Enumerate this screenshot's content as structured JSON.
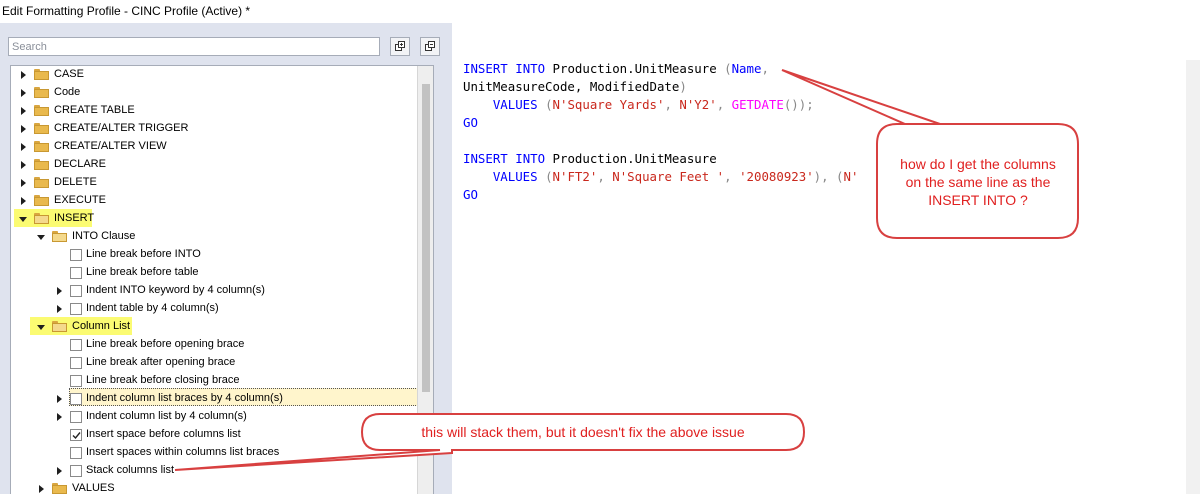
{
  "window": {
    "title": "Edit Formatting Profile - CINC Profile (Active) *"
  },
  "search": {
    "placeholder": "Search",
    "value": ""
  },
  "toolbar": {
    "expand_icon": "expand-all-icon",
    "collapse_icon": "collapse-all-icon"
  },
  "tree": {
    "items": [
      {
        "label": "CASE"
      },
      {
        "label": "Code"
      },
      {
        "label": "CREATE TABLE"
      },
      {
        "label": "CREATE/ALTER TRIGGER"
      },
      {
        "label": "CREATE/ALTER VIEW"
      },
      {
        "label": "DECLARE"
      },
      {
        "label": "DELETE"
      },
      {
        "label": "EXECUTE"
      },
      {
        "label": "INSERT"
      },
      {
        "label": "INTO Clause"
      },
      {
        "label": "Line break before INTO",
        "checked": false
      },
      {
        "label": "Line break before table",
        "checked": false
      },
      {
        "label": "Indent INTO keyword by 4 column(s)",
        "checked": false
      },
      {
        "label": "Indent table by 4 column(s)",
        "checked": false
      },
      {
        "label": "Column List"
      },
      {
        "label": "Line break before opening brace",
        "checked": false
      },
      {
        "label": "Line break after opening brace",
        "checked": false
      },
      {
        "label": "Line break before closing brace",
        "checked": false
      },
      {
        "label": "Indent column list braces by 4 column(s)",
        "checked": false
      },
      {
        "label": "Indent column list by 4 column(s)",
        "checked": false
      },
      {
        "label": "Insert space before columns list",
        "checked": true
      },
      {
        "label": "Insert spaces within columns list braces",
        "checked": false
      },
      {
        "label": "Stack columns list",
        "checked": false
      },
      {
        "label": "VALUES"
      }
    ]
  },
  "editor": {
    "lines": [
      [
        "INSERT",
        " ",
        "INTO",
        " Production.UnitMeasure ",
        "(",
        "Name",
        ","
      ],
      [
        "UnitMeasureCode, ModifiedDate",
        ")"
      ],
      [
        "    ",
        "VALUES",
        " ",
        "(",
        "N'Square Yards'",
        ", ",
        "N'Y2'",
        ", ",
        "GETDATE",
        "());"
      ],
      [
        "GO"
      ],
      [
        ""
      ],
      [
        "INSERT",
        " ",
        "INTO",
        " Production.UnitMeasure"
      ],
      [
        "    ",
        "VALUES",
        " ",
        "(",
        "N'FT2'",
        ", ",
        "N'Square Feet '",
        ", ",
        "'20080923'",
        "), (",
        "N'"
      ],
      [
        "GO"
      ]
    ]
  },
  "annotations": {
    "callout_1": {
      "lines": [
        "how do I get the columns",
        "on the same line as the",
        "INSERT INTO ?"
      ]
    },
    "callout_2": {
      "text": "this will stack them, but it doesn't fix the above issue"
    }
  },
  "colors": {
    "callout": "#e02020",
    "highlight": "#fbfb72",
    "keyword": "#0000ff",
    "string": "#c9281d",
    "function": "#ff00ff"
  }
}
